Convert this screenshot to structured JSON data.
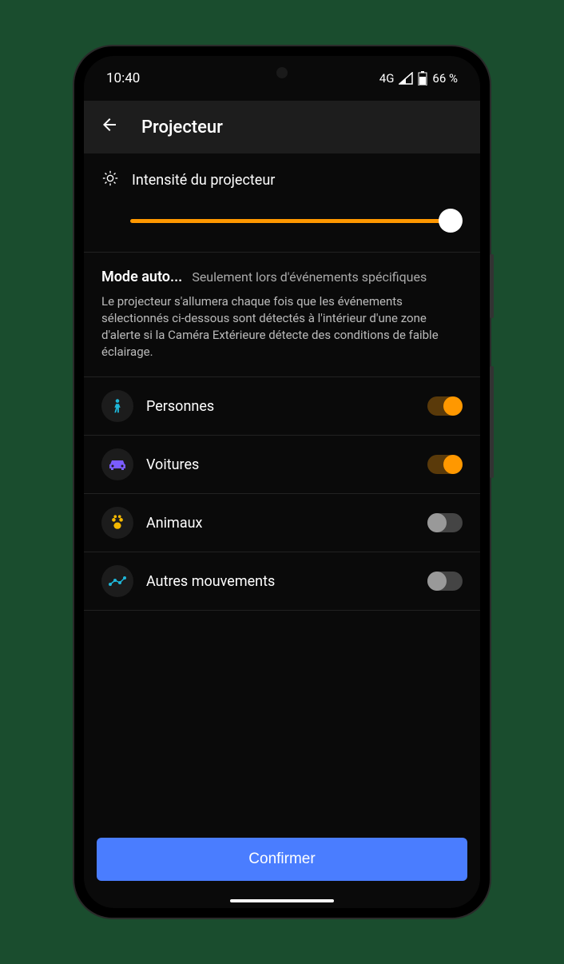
{
  "status": {
    "time": "10:40",
    "network": "4G",
    "battery": "66 %"
  },
  "header": {
    "title": "Projecteur"
  },
  "intensity": {
    "label": "Intensité du projecteur",
    "value": 100
  },
  "mode": {
    "title": "Mode auto...",
    "subtitle": "Seulement lors d'événements spécifiques",
    "description": "Le projecteur s'allumera chaque fois que les événements sélectionnés ci-dessous sont détectés à l'intérieur d'une zone d'alerte si la Caméra Extérieure détecte des conditions de faible éclairage."
  },
  "rows": [
    {
      "id": "persons",
      "label": "Personnes",
      "icon": "person-icon",
      "color": "#1fb6d8",
      "enabled": true
    },
    {
      "id": "cars",
      "label": "Voitures",
      "icon": "car-icon",
      "color": "#7a5cff",
      "enabled": true
    },
    {
      "id": "animals",
      "label": "Animaux",
      "icon": "paw-icon",
      "color": "#f5b800",
      "enabled": false
    },
    {
      "id": "other",
      "label": "Autres mouvements",
      "icon": "motion-icon",
      "color": "#1fb6d8",
      "enabled": false
    }
  ],
  "footer": {
    "confirm": "Confirmer"
  }
}
